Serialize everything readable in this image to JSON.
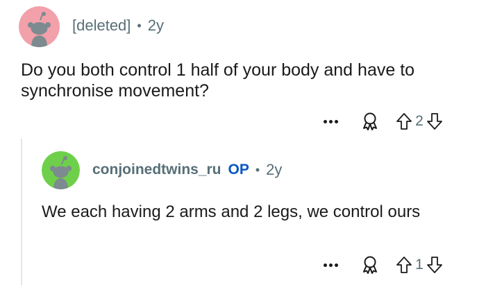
{
  "comment": {
    "author": "[deleted]",
    "separator": "•",
    "age": "2y",
    "body": "Do you both control 1 half of your body and have to synchronise movement?",
    "score": "2",
    "icons": {
      "avatar": "snoo-avatar-icon",
      "more": "more-options-icon",
      "award": "award-icon",
      "upvote": "upvote-arrow-icon",
      "downvote": "downvote-arrow-icon"
    },
    "colors": {
      "avatar_bg": "#f2a0aa"
    }
  },
  "reply": {
    "author": "conjoinedtwins_ru",
    "op_badge": "OP",
    "separator": "•",
    "age": "2y",
    "body": "We each having 2 arms and 2 legs, we control ours",
    "score": "1",
    "colors": {
      "avatar_bg": "#6ed04a",
      "op_badge": "#0a56c2"
    }
  },
  "colors": {
    "text": "#1a1a1b",
    "meta": "#576f76",
    "thread_line": "#e2e6e8"
  }
}
